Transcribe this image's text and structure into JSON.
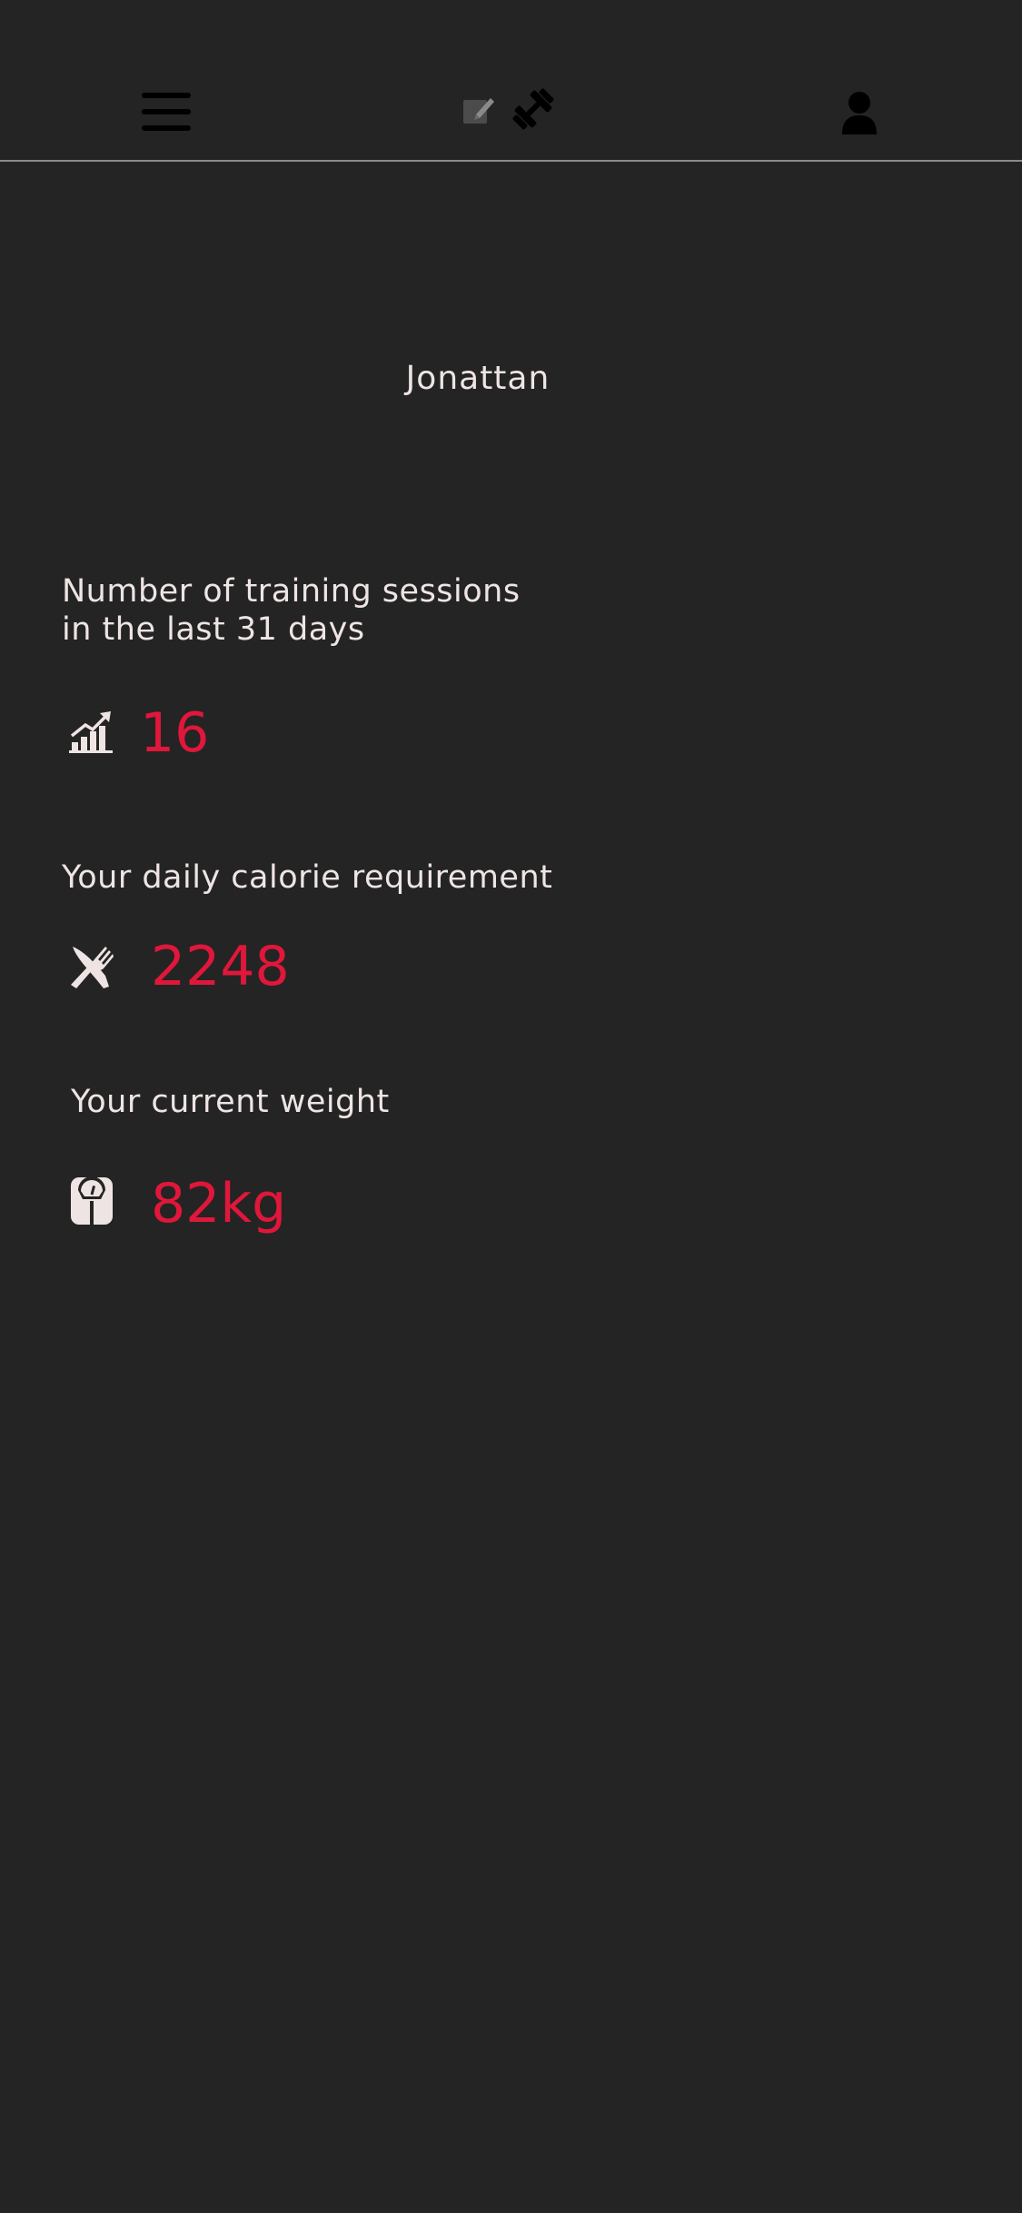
{
  "header": {
    "menu_icon": "hamburger-icon",
    "logo_icons": [
      "edit-note-icon",
      "dumbbell-icon"
    ],
    "profile_icon": "user-icon"
  },
  "profile": {
    "username": "Jonattan"
  },
  "stats": {
    "sessions": {
      "label_line1": "Number of training sessions",
      "label_line2": "in the last 31 days",
      "value": "16",
      "icon": "progress-chart-icon"
    },
    "calories": {
      "label": "Your daily calorie requirement",
      "value": "2248",
      "icon": "fork-knife-icon"
    },
    "weight": {
      "label": "Your current weight",
      "value": "82kg",
      "icon": "scale-icon"
    }
  },
  "colors": {
    "background": "#242424",
    "text": "#efe4e4",
    "accent": "#e0173a"
  }
}
